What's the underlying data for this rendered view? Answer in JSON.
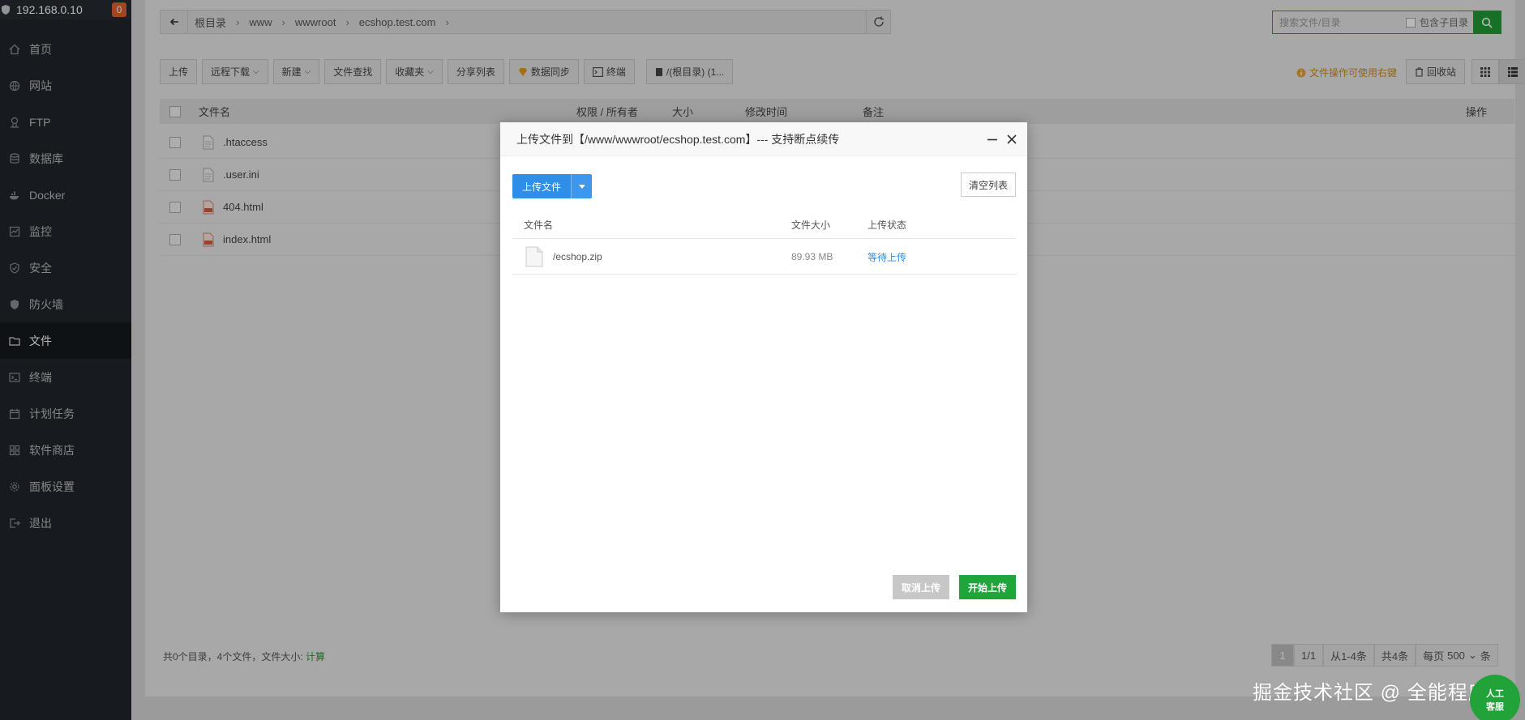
{
  "sidebar": {
    "host": "192.168.0.10",
    "badge": "0",
    "items": [
      {
        "label": "首页",
        "icon": "home-icon"
      },
      {
        "label": "网站",
        "icon": "globe-icon"
      },
      {
        "label": "FTP",
        "icon": "ftp-icon"
      },
      {
        "label": "数据库",
        "icon": "database-icon"
      },
      {
        "label": "Docker",
        "icon": "docker-icon"
      },
      {
        "label": "监控",
        "icon": "monitor-icon"
      },
      {
        "label": "安全",
        "icon": "shield-icon"
      },
      {
        "label": "防火墙",
        "icon": "firewall-icon"
      },
      {
        "label": "文件",
        "icon": "folder-icon"
      },
      {
        "label": "终端",
        "icon": "terminal-icon"
      },
      {
        "label": "计划任务",
        "icon": "calendar-icon"
      },
      {
        "label": "软件商店",
        "icon": "apps-icon"
      },
      {
        "label": "面板设置",
        "icon": "gear-icon"
      },
      {
        "label": "退出",
        "icon": "logout-icon"
      }
    ],
    "active": "文件"
  },
  "path": {
    "crumbs": [
      "根目录",
      "www",
      "wwwroot",
      "ecshop.test.com"
    ]
  },
  "search": {
    "placeholder": "搜索文件/目录",
    "include_sub": "包含子目录"
  },
  "toolbar": {
    "upload": "上传",
    "remote_download": "远程下载",
    "new": "新建",
    "file_search": "文件查找",
    "favorites": "收藏夹",
    "share_list": "分享列表",
    "data_sync": "数据同步",
    "terminal": "终端",
    "disk": "/(根目录) (1..."
  },
  "tip": "文件操作可使用右键",
  "recycle": "回收站",
  "table": {
    "headers": {
      "name": "文件名",
      "perm": "权限 / 所有者",
      "size": "大小",
      "mtime": "修改时间",
      "note": "备注",
      "op": "操作"
    },
    "rows": [
      {
        "name": ".htaccess",
        "type": "text"
      },
      {
        "name": ".user.ini",
        "type": "text"
      },
      {
        "name": "404.html",
        "type": "html"
      },
      {
        "name": "index.html",
        "type": "html"
      }
    ]
  },
  "footer": {
    "summary": "共0个目录，4个文件，文件大小: ",
    "calc": "计算"
  },
  "pager": {
    "current": "1",
    "pages": "1/1",
    "range": "从1-4条",
    "total": "共4条",
    "per_page_label": "每页",
    "per_page": "500",
    "unit": "条"
  },
  "dialog": {
    "title": "上传文件到【/www/wwwroot/ecshop.test.com】--- 支持断点续传",
    "upload_btn": "上传文件",
    "clear_btn": "清空列表",
    "headers": {
      "name": "文件名",
      "size": "文件大小",
      "status": "上传状态"
    },
    "file": {
      "name": "/ecshop.zip",
      "size": "89.93 MB",
      "status": "等待上传"
    },
    "cancel_btn": "取消上传",
    "start_btn": "开始上传"
  },
  "watermark": "掘金技术社区 @ 全能程序员",
  "kefu": {
    "line1": "人工",
    "line2": "客服"
  },
  "colors": {
    "sidebar_bg": "#20252b",
    "accent_green": "#20a53a",
    "accent_blue": "#2f8ee8",
    "tip_orange": "#d08a20"
  }
}
